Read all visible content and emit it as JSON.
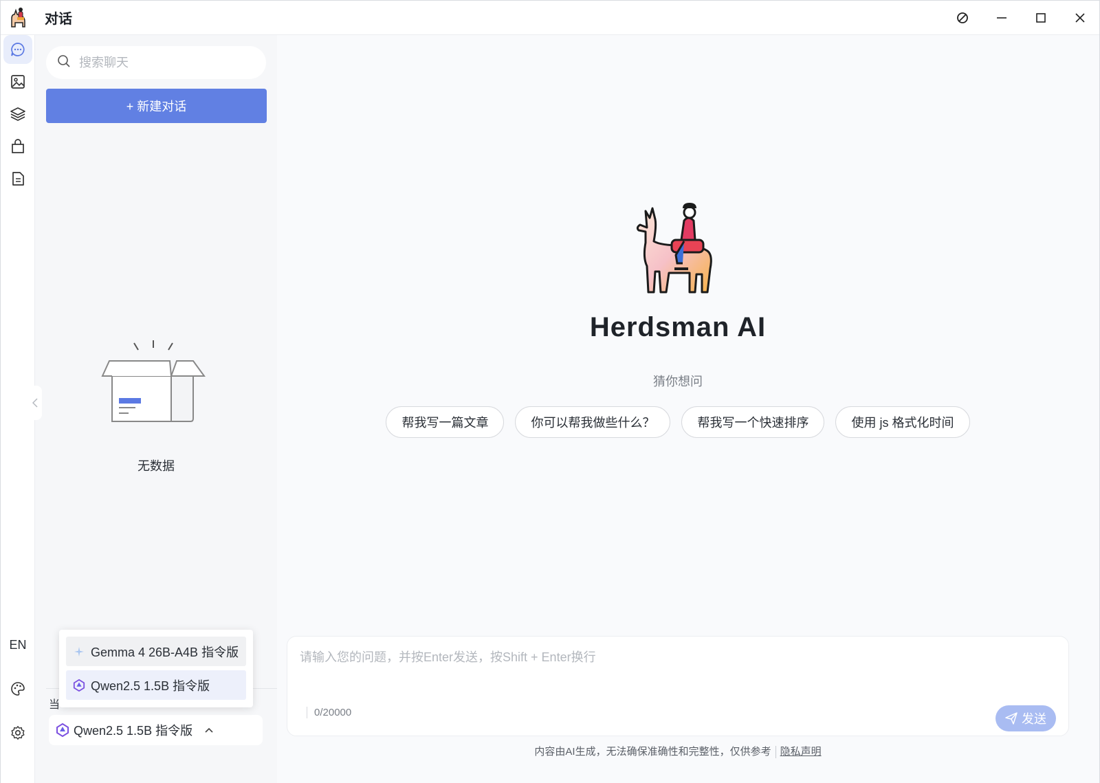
{
  "titlebar": {
    "title": "对话",
    "controls": [
      "block-icon",
      "minimize-icon",
      "maximize-icon",
      "close-icon"
    ]
  },
  "rail": {
    "items": [
      "chat-icon",
      "image-icon",
      "layers-icon",
      "bag-icon",
      "document-icon"
    ],
    "language": "EN",
    "bottom": [
      "palette-icon",
      "settings-icon"
    ]
  },
  "sidebar": {
    "search_placeholder": "搜索聊天",
    "new_chat_label": "+ 新建对话",
    "empty_text": "无数据",
    "current_label": "当",
    "current_model": "Qwen2.5 1.5B 指令版"
  },
  "model_dropdown": {
    "options": [
      {
        "label": "Gemma 4 26B-A4B 指令版",
        "icon": "gemma-icon"
      },
      {
        "label": "Qwen2.5 1.5B 指令版",
        "icon": "qwen-icon"
      }
    ],
    "selected": "Qwen2.5 1.5B 指令版"
  },
  "main": {
    "brand": "Herdsman AI",
    "guess_title": "猜你想问",
    "suggestions": [
      "帮我写一篇文章",
      "你可以帮我做些什么？",
      "帮我写一个快速排序",
      "使用 js 格式化时间"
    ],
    "input_placeholder": "请输入您的问题，并按Enter发送，按Shift + Enter换行",
    "counter": "0/20000",
    "send_label": "发送",
    "disclaimer": "内容由AI生成，无法确保准确性和完整性，仅供参考",
    "privacy_link": "隐私声明"
  },
  "colors": {
    "accent": "#6180e3",
    "send_disabled": "#a9bcf2",
    "sidebar_bg": "#f6f7f9",
    "main_bg": "#f9fafc"
  }
}
